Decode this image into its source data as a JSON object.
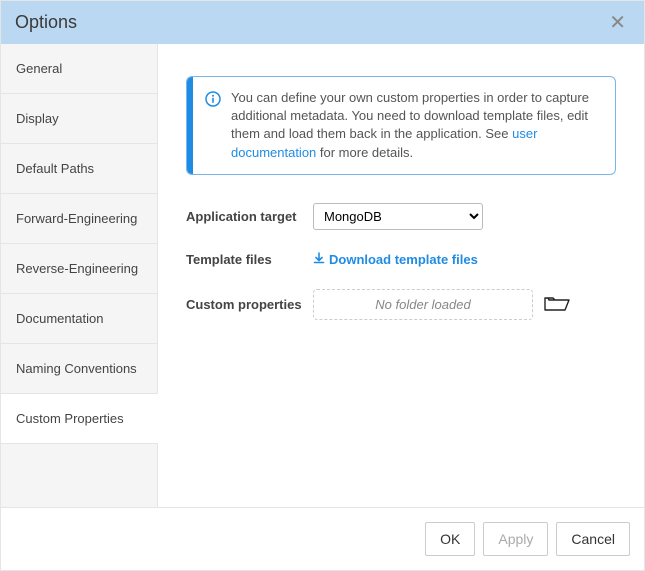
{
  "header": {
    "title": "Options"
  },
  "sidebar": {
    "items": [
      {
        "label": "General"
      },
      {
        "label": "Display"
      },
      {
        "label": "Default Paths"
      },
      {
        "label": "Forward-Engineering"
      },
      {
        "label": "Reverse-Engineering"
      },
      {
        "label": "Documentation"
      },
      {
        "label": "Naming Conventions"
      },
      {
        "label": "Custom Properties"
      }
    ],
    "active_index": 7
  },
  "info": {
    "text_before_link": "You can define your own custom properties in order to capture additional metadata. You need to download template files, edit them and load them back in the application. See ",
    "link_text": "user documentation",
    "text_after_link": " for more details."
  },
  "form": {
    "app_target_label": "Application target",
    "app_target_value": "MongoDB",
    "template_files_label": "Template files",
    "download_link": "Download template files",
    "custom_props_label": "Custom properties",
    "custom_props_placeholder": "No folder loaded"
  },
  "footer": {
    "ok": "OK",
    "apply": "Apply",
    "cancel": "Cancel"
  }
}
